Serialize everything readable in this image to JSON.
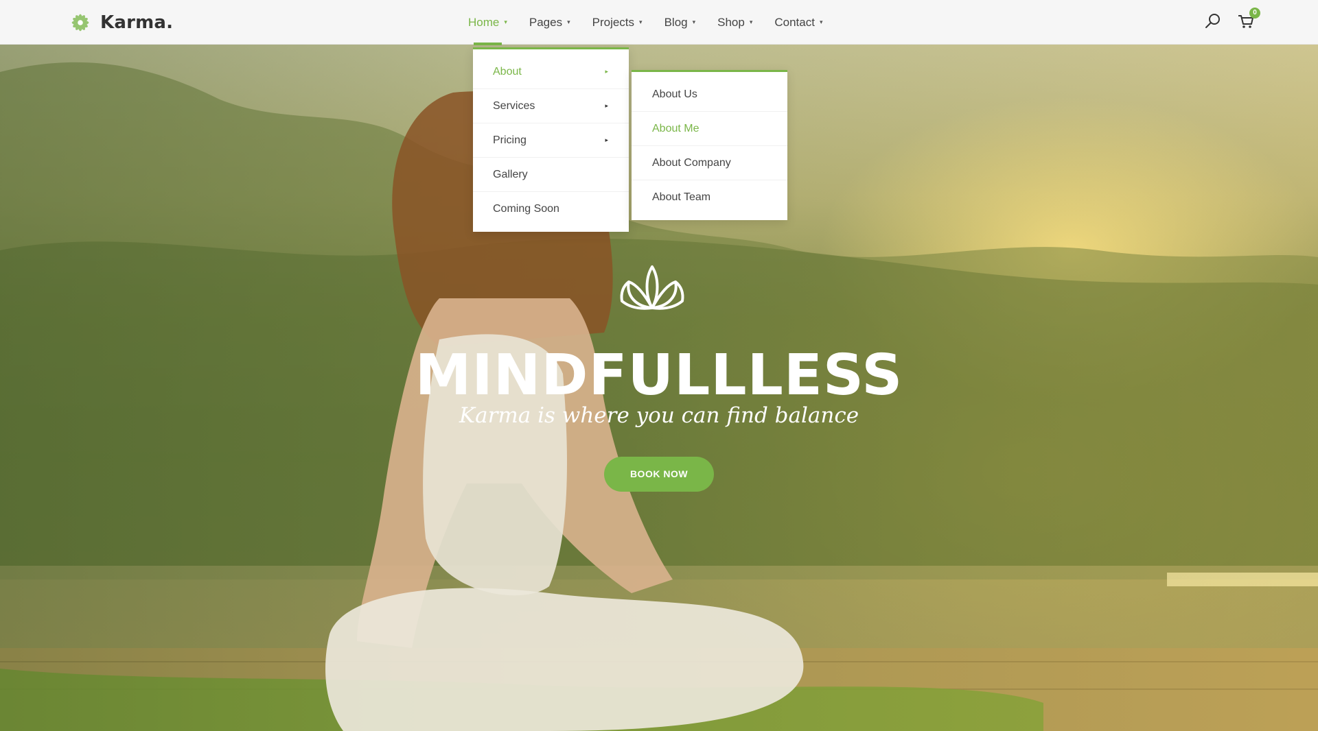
{
  "brand": {
    "name": "Karma.",
    "accent": "#7ab648"
  },
  "nav": {
    "items": [
      {
        "label": "Home",
        "active": true
      },
      {
        "label": "Pages",
        "active": false
      },
      {
        "label": "Projects",
        "active": false
      },
      {
        "label": "Blog",
        "active": false
      },
      {
        "label": "Shop",
        "active": false
      },
      {
        "label": "Contact",
        "active": false
      }
    ],
    "caret": "▾"
  },
  "header_icons": {
    "search": "search-icon",
    "cart": "cart-icon",
    "cart_count": "0"
  },
  "dropdown": {
    "items": [
      {
        "label": "About",
        "has_submenu": true,
        "active": true
      },
      {
        "label": "Services",
        "has_submenu": true,
        "active": false
      },
      {
        "label": "Pricing",
        "has_submenu": true,
        "active": false
      },
      {
        "label": "Gallery",
        "has_submenu": false,
        "active": false
      },
      {
        "label": "Coming Soon",
        "has_submenu": false,
        "active": false
      }
    ],
    "arrow": "▸"
  },
  "submenu": {
    "items": [
      {
        "label": "About Us",
        "active": false
      },
      {
        "label": "About Me",
        "active": true
      },
      {
        "label": "About Company",
        "active": false
      },
      {
        "label": "About Team",
        "active": false
      }
    ]
  },
  "hero": {
    "icon": "lotus-icon",
    "title": "MINDFULLLESS",
    "subtitle": "Karma is where you can find balance",
    "cta_label": "BOOK NOW"
  }
}
